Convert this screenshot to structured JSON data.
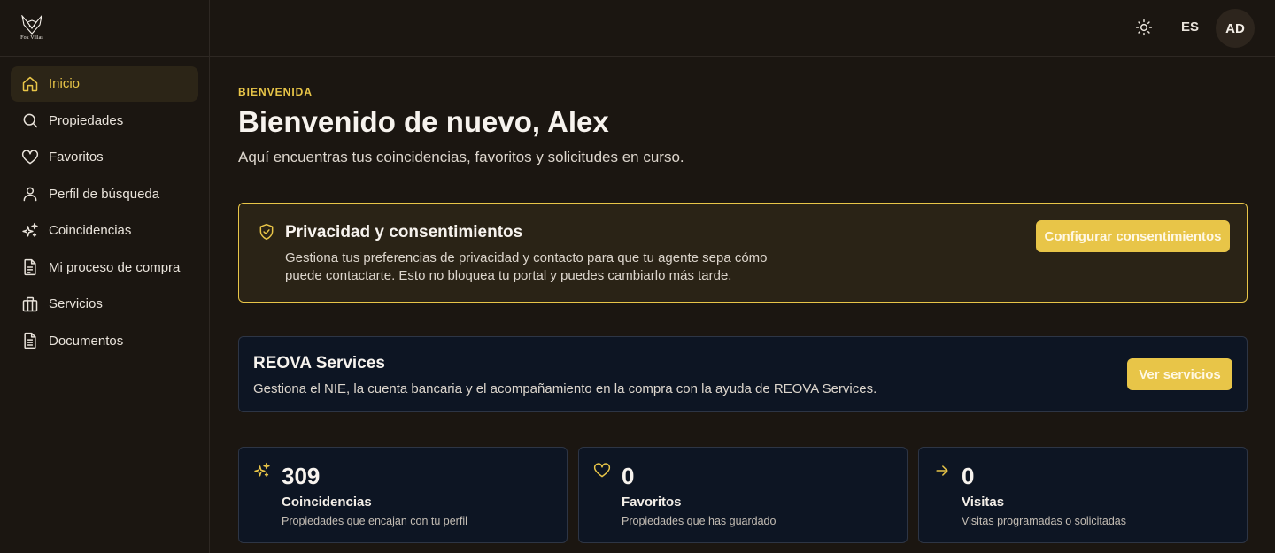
{
  "brand": {
    "logo_text": "Fox Villas"
  },
  "sidebar": {
    "items": [
      {
        "label": "Inicio",
        "icon": "home-icon",
        "active": true
      },
      {
        "label": "Propiedades",
        "icon": "search-icon"
      },
      {
        "label": "Favoritos",
        "icon": "heart-icon"
      },
      {
        "label": "Perfil de búsqueda",
        "icon": "user-icon"
      },
      {
        "label": "Coincidencias",
        "icon": "sparkles-icon"
      },
      {
        "label": "Mi proceso de compra",
        "icon": "document-icon"
      },
      {
        "label": "Servicios",
        "icon": "briefcase-icon"
      },
      {
        "label": "Documentos",
        "icon": "file-icon"
      }
    ]
  },
  "topbar": {
    "theme_icon": "sun-icon",
    "language": "ES",
    "avatar_initials": "AD"
  },
  "header": {
    "eyebrow": "BIENVENIDA",
    "title": "Bienvenido de nuevo, Alex",
    "subtitle": "Aquí encuentras tus coincidencias, favoritos y solicitudes en curso."
  },
  "privacy": {
    "title": "Privacidad y consentimientos",
    "text": "Gestiona tus preferencias de privacidad y contacto para que tu agente sepa cómo puede contactarte. Esto no bloquea tu portal y puedes cambiarlo más tarde.",
    "button": "Configurar consentimientos"
  },
  "services": {
    "title": "REOVA Services",
    "text": "Gestiona el NIE, la cuenta bancaria y el acompañamiento en la compra con la ayuda de REOVA Services.",
    "button": "Ver servicios"
  },
  "stats": [
    {
      "value": "309",
      "label": "Coincidencias",
      "desc": "Propiedades que encajan con tu perfil",
      "icon": "sparkles-icon"
    },
    {
      "value": "0",
      "label": "Favoritos",
      "desc": "Propiedades que has guardado",
      "icon": "heart-icon"
    },
    {
      "value": "0",
      "label": "Visitas",
      "desc": "Visitas programadas o solicitadas",
      "icon": "arrow-right-icon"
    }
  ],
  "colors": {
    "accent": "#e8c548",
    "background": "#1b1611",
    "card": "#0d1523"
  }
}
